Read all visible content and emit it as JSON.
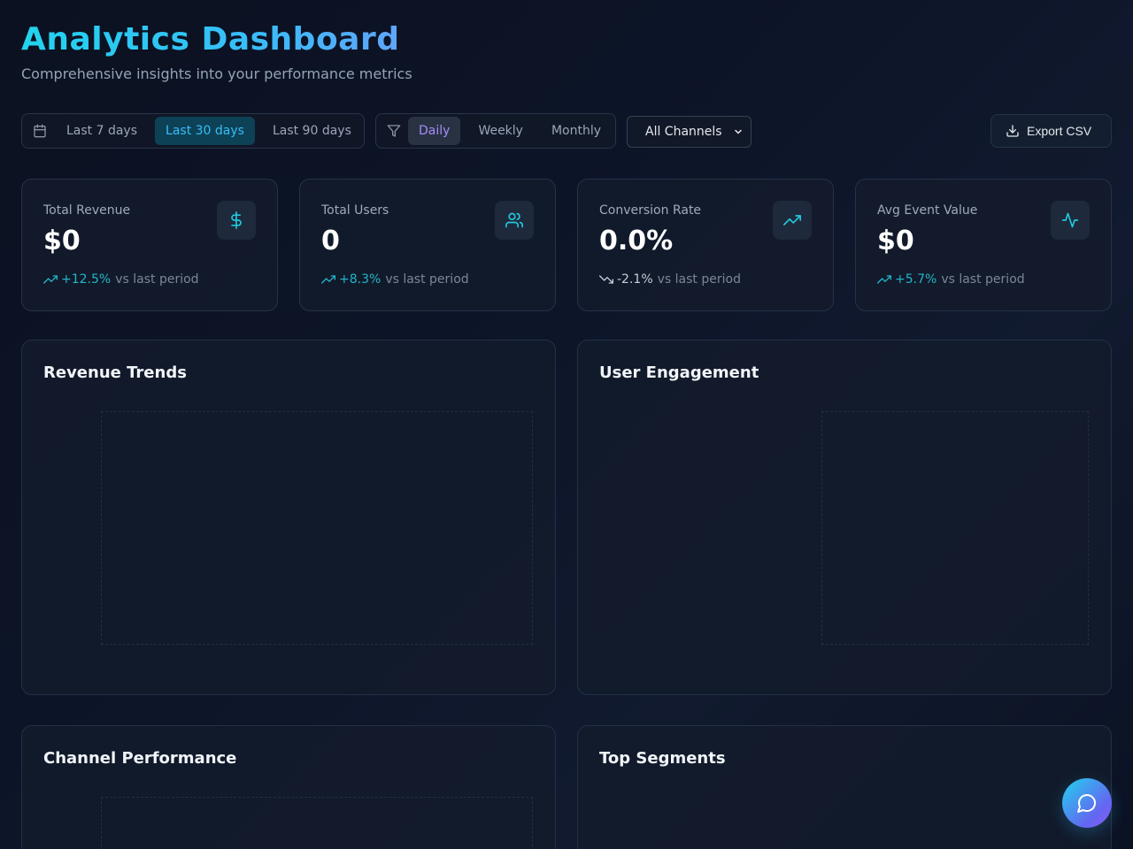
{
  "header": {
    "title": "Analytics Dashboard",
    "subtitle": "Comprehensive insights into your performance metrics"
  },
  "toolbar": {
    "ranges": [
      "Last 7 days",
      "Last 30 days",
      "Last 90 days"
    ],
    "active_range": "Last 30 days",
    "granularity": [
      "Daily",
      "Weekly",
      "Monthly"
    ],
    "active_granularity": "Daily",
    "channel_select": "All Channels",
    "export_label": "Export CSV"
  },
  "kpis": [
    {
      "label": "Total Revenue",
      "value": "$0",
      "trend": "+12.5%",
      "direction": "up",
      "suffix": "vs last period",
      "icon": "dollar-icon"
    },
    {
      "label": "Total Users",
      "value": "0",
      "trend": "+8.3%",
      "direction": "up",
      "suffix": "vs last period",
      "icon": "users-icon"
    },
    {
      "label": "Conversion Rate",
      "value": "0.0%",
      "trend": "-2.1%",
      "direction": "down",
      "suffix": "vs last period",
      "icon": "trending-up-icon"
    },
    {
      "label": "Avg Event Value",
      "value": "$0",
      "trend": "+5.7%",
      "direction": "up",
      "suffix": "vs last period",
      "icon": "activity-icon"
    }
  ],
  "panels": {
    "revenue_trends": "Revenue Trends",
    "user_engagement": "User Engagement",
    "channel_performance": "Channel Performance",
    "top_segments": "Top Segments"
  },
  "colors": {
    "accent": "#38bdf8",
    "trend_up": "#22b5c9",
    "granularity_active": "#a78bfa"
  }
}
